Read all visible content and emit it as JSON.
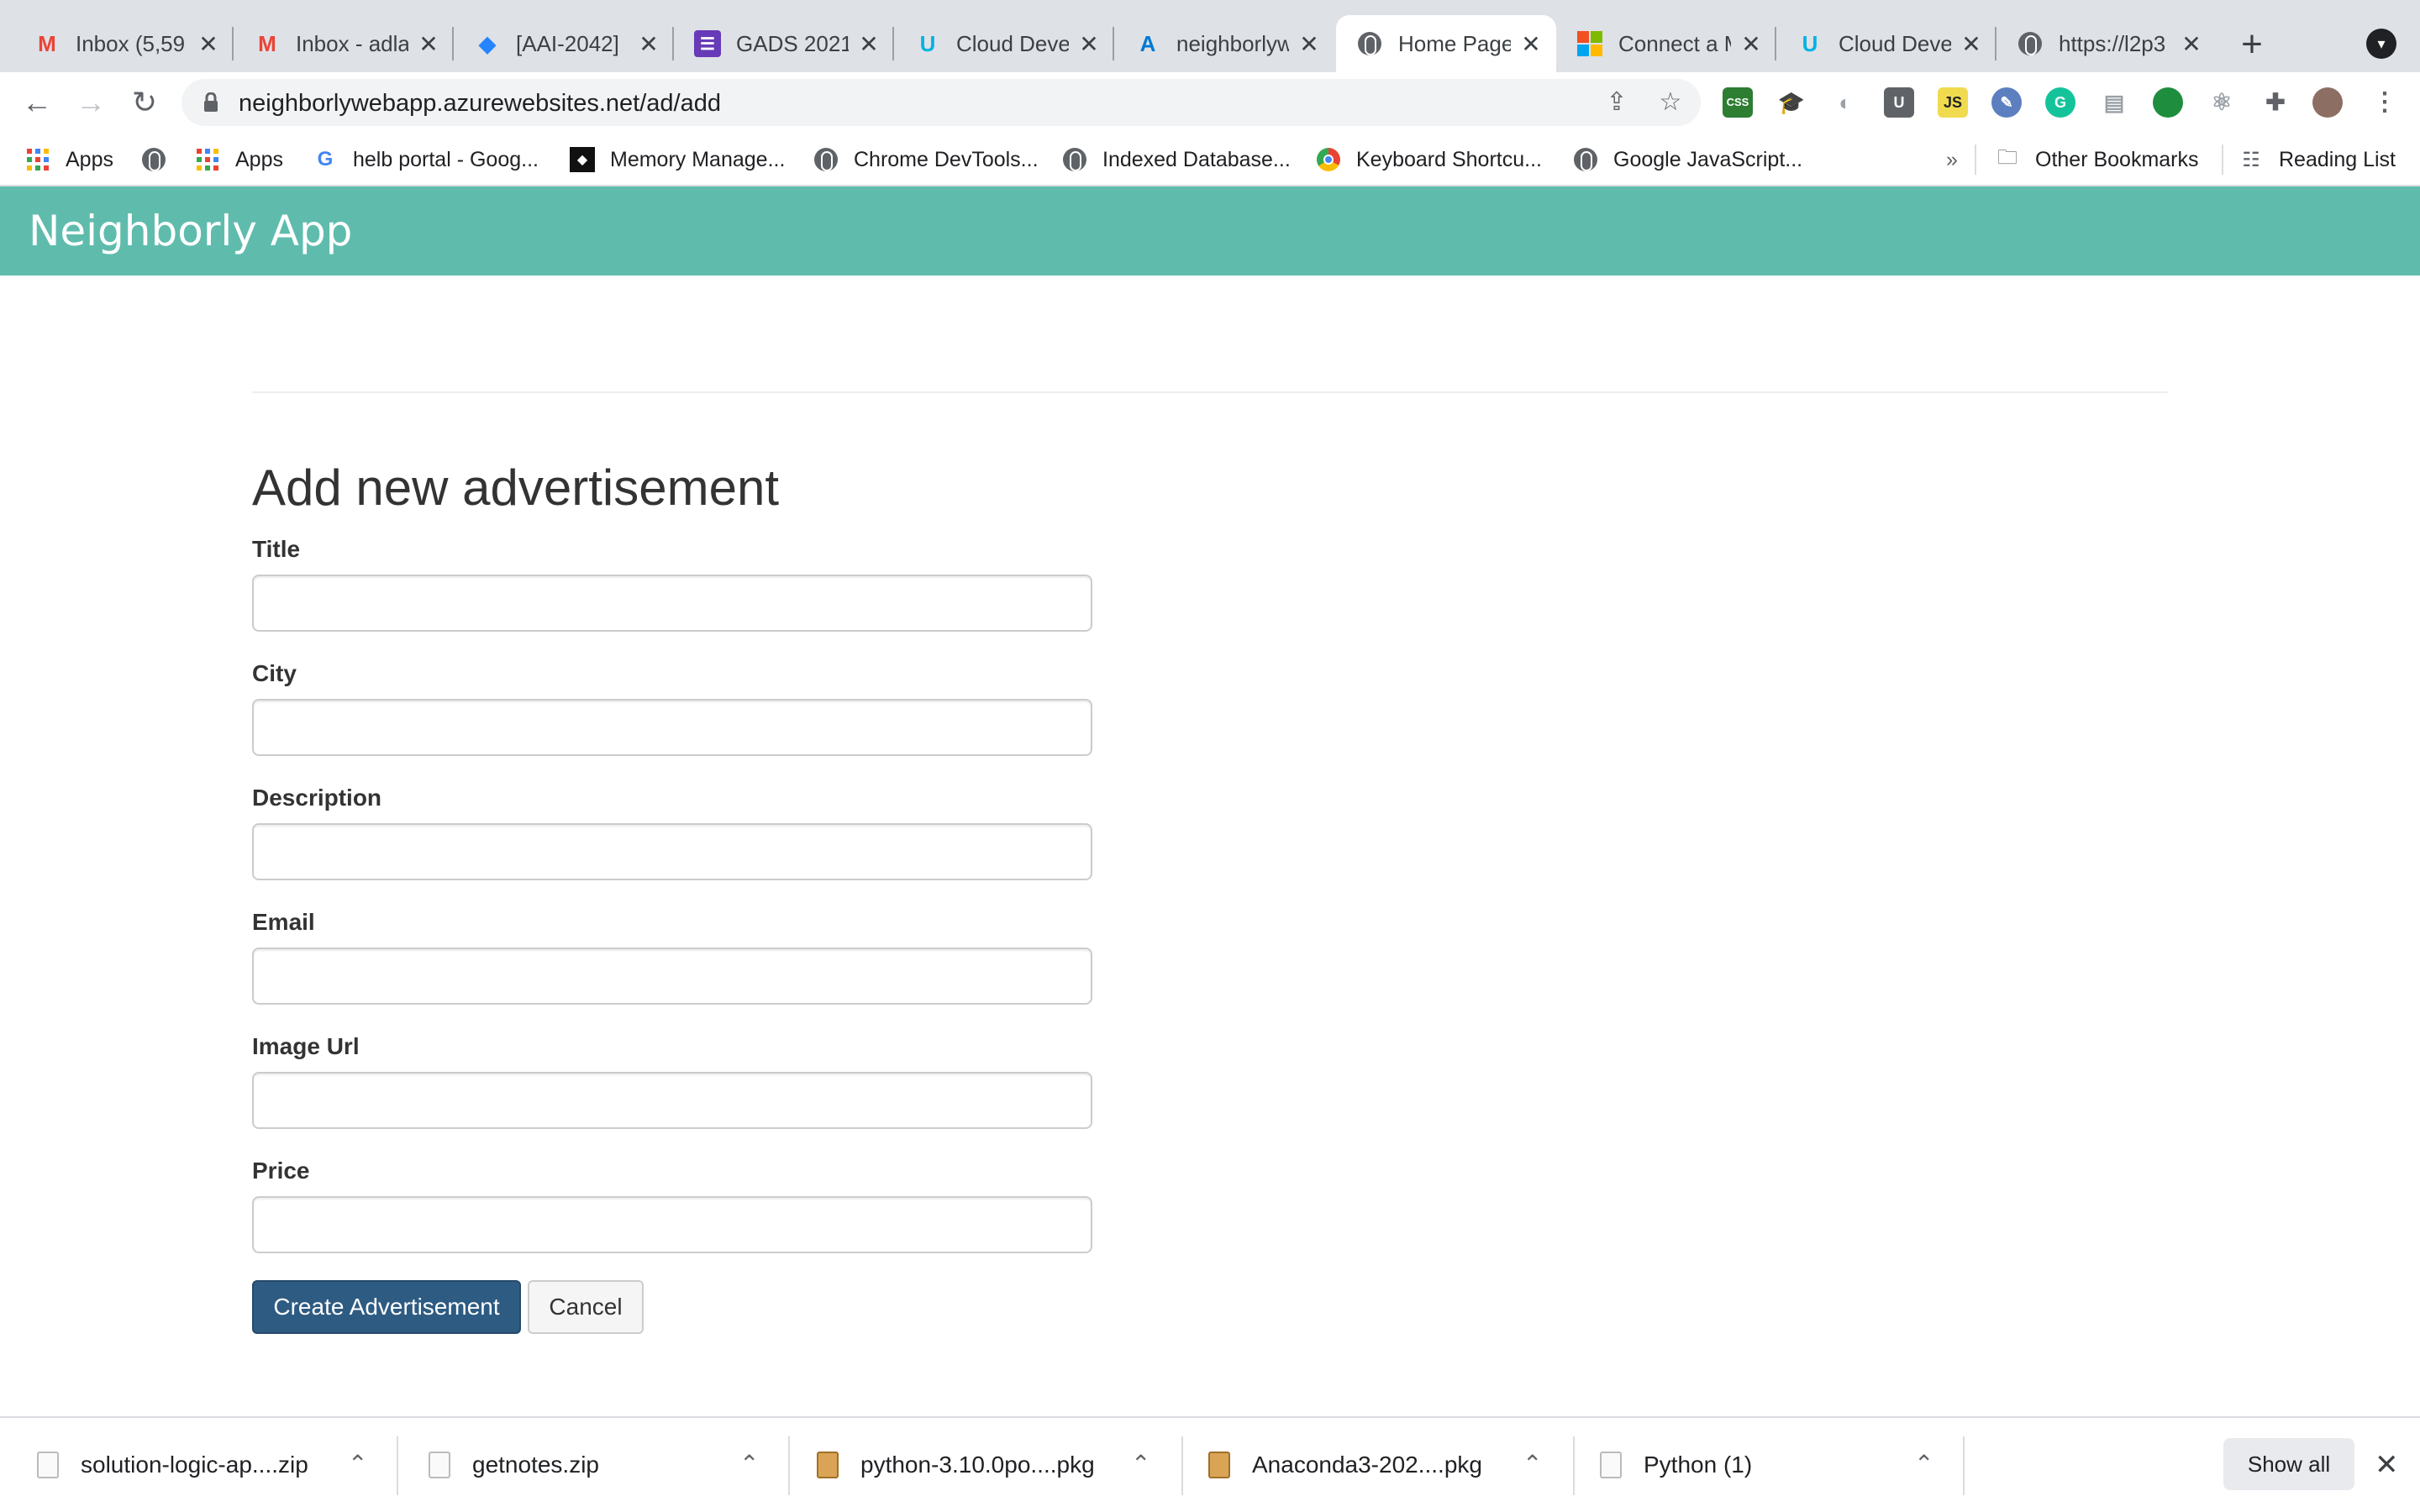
{
  "browser": {
    "tabs": [
      {
        "label": "Inbox (5,59",
        "icon": "gmail-icon",
        "active": false
      },
      {
        "label": "Inbox - adla",
        "icon": "gmail-icon",
        "active": false
      },
      {
        "label": "[AAI-2042]",
        "icon": "jira-icon",
        "active": false
      },
      {
        "label": "GADS 2021",
        "icon": "forms-icon",
        "active": false
      },
      {
        "label": "Cloud Deve",
        "icon": "udacity-icon",
        "active": false
      },
      {
        "label": "neighborlyw",
        "icon": "azure-icon",
        "active": false
      },
      {
        "label": "Home Page",
        "icon": "globe-icon",
        "active": true
      },
      {
        "label": "Connect a M",
        "icon": "microsoft-icon",
        "active": false
      },
      {
        "label": "Cloud Deve",
        "icon": "udacity-icon",
        "active": false
      },
      {
        "label": "https://l2p3",
        "icon": "globe-icon",
        "active": false
      }
    ],
    "url": "neighborlywebapp.azurewebsites.net/ad/add",
    "extensions": [
      "css-icon",
      "graduation-cap-icon",
      "owl-icon",
      "u-icon",
      "js-icon",
      "edit-icon",
      "grammarly-icon",
      "clipboard-icon",
      "chat-icon",
      "react-icon",
      "puzzle-icon",
      "profile-avatar"
    ],
    "bookmarks": [
      {
        "label": "Apps",
        "icon": "apps-grid-icon"
      },
      {
        "label": "",
        "icon": "globe-icon"
      },
      {
        "label": "Apps",
        "icon": "apps-grid-icon"
      },
      {
        "label": "helb portal - Goog...",
        "icon": "google-icon"
      },
      {
        "label": "Memory Manage...",
        "icon": "memory-icon"
      },
      {
        "label": "Chrome DevTools...",
        "icon": "globe-icon"
      },
      {
        "label": "Indexed Database...",
        "icon": "globe-icon"
      },
      {
        "label": "Keyboard Shortcu...",
        "icon": "chrome-icon"
      },
      {
        "label": "Google JavaScript...",
        "icon": "globe-icon"
      }
    ],
    "bookmarks_overflow": "»",
    "other_bookmarks": "Other Bookmarks",
    "reading_list": "Reading List"
  },
  "app": {
    "brand": "Neighborly App",
    "heading": "Add new advertisement",
    "fields": [
      {
        "label": "Title",
        "value": ""
      },
      {
        "label": "City",
        "value": ""
      },
      {
        "label": "Description",
        "value": ""
      },
      {
        "label": "Email",
        "value": ""
      },
      {
        "label": "Image Url",
        "value": ""
      },
      {
        "label": "Price",
        "value": ""
      }
    ],
    "submit_label": "Create Advertisement",
    "cancel_label": "Cancel",
    "colors": {
      "header": "#5fbcad",
      "primary_button": "#2e5b82"
    }
  },
  "downloads": {
    "items": [
      {
        "name": "solution-logic-ap....zip",
        "type": "zip"
      },
      {
        "name": "getnotes.zip",
        "type": "zip"
      },
      {
        "name": "python-3.10.0po....pkg",
        "type": "pkg"
      },
      {
        "name": "Anaconda3-202....pkg",
        "type": "pkg"
      },
      {
        "name": "Python (1)",
        "type": "file"
      }
    ],
    "show_all": "Show all"
  }
}
